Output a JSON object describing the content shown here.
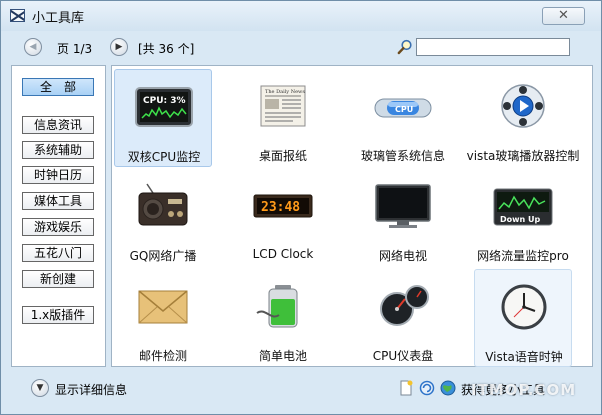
{
  "window": {
    "title": "小工具库",
    "close_glyph": "✕"
  },
  "nav": {
    "prev_icon": "chevron-left-icon",
    "next_icon": "chevron-right-icon",
    "page_label": "页 1/3",
    "total_label": "[共 36 个]",
    "search_icon": "magnifier-icon",
    "search_value": ""
  },
  "sidebar": {
    "categories": [
      {
        "label": "全　部",
        "active": true
      },
      {
        "label": "信息资讯"
      },
      {
        "label": "系统辅助"
      },
      {
        "label": "时钟日历"
      },
      {
        "label": "媒体工具"
      },
      {
        "label": "游戏娱乐"
      },
      {
        "label": "五花八门"
      },
      {
        "label": "新创建"
      },
      {
        "label": "1.x版插件"
      }
    ]
  },
  "gadgets": [
    {
      "label": "双核CPU监控",
      "icon": "cpu-meter-icon",
      "icon_text": "CPU: 3%",
      "state": "selected"
    },
    {
      "label": "桌面报纸",
      "icon": "newspaper-icon",
      "icon_text": "The Daily News"
    },
    {
      "label": "玻璃管系统信息",
      "icon": "cpu-pill-icon",
      "icon_text": "CPU"
    },
    {
      "label": "vista玻璃播放器控制",
      "icon": "media-player-icon"
    },
    {
      "label": "GQ网络广播",
      "icon": "radio-icon"
    },
    {
      "label": "LCD Clock",
      "icon": "lcd-clock-icon",
      "icon_text": "23:48"
    },
    {
      "label": "网络电视",
      "icon": "monitor-icon"
    },
    {
      "label": "网络流量监控pro",
      "icon": "network-monitor-icon",
      "icon_text": "Down Up"
    },
    {
      "label": "邮件检测",
      "icon": "envelope-icon"
    },
    {
      "label": "简单电池",
      "icon": "battery-icon"
    },
    {
      "label": "CPU仪表盘",
      "icon": "gauge-icon"
    },
    {
      "label": "Vista语音时钟",
      "icon": "analog-clock-icon",
      "state": "hovered"
    }
  ],
  "statusbar": {
    "toggle_icon": "chevron-down-icon",
    "details_label": "显示详细信息",
    "new_icon": "new-document-icon",
    "refresh_icon": "refresh-icon",
    "globe_icon": "globe-icon",
    "more_label": "获得更多小工具"
  },
  "watermark": "ITMOP.COM"
}
